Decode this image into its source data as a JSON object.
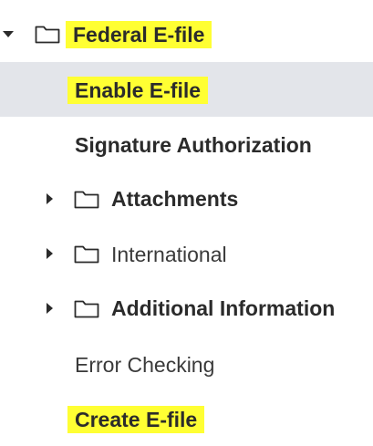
{
  "tree": {
    "items": [
      {
        "label": "Federal E-file"
      },
      {
        "label": "Enable E-file"
      },
      {
        "label": "Signature Authorization"
      },
      {
        "label": "Attachments"
      },
      {
        "label": "International"
      },
      {
        "label": "Additional Information"
      },
      {
        "label": "Error Checking"
      },
      {
        "label": "Create E-file"
      }
    ]
  },
  "colors": {
    "highlight": "#ffff33",
    "selected_row": "#e3e5ea",
    "text": "#2b2b2b"
  },
  "icons": [
    "chevron-down-icon",
    "chevron-right-icon",
    "folder-icon"
  ]
}
